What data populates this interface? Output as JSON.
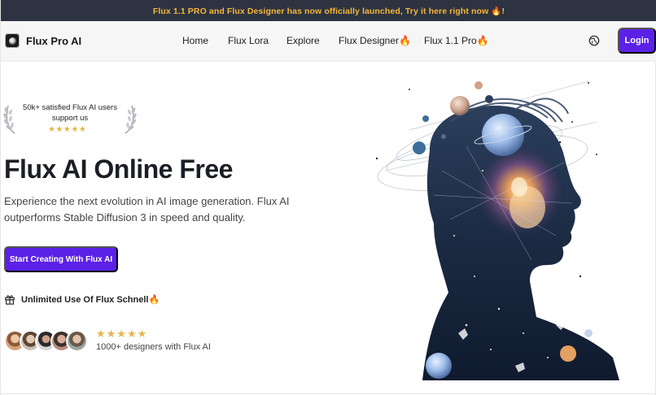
{
  "announcement": "Flux 1.1 PRO and Flux Designer has now officially launched, Try it here right now 🔥!",
  "nav": {
    "brand": "Flux Pro AI",
    "links": [
      "Home",
      "Flux Lora",
      "Explore",
      "Flux Designer🔥",
      "Flux 1.1 Pro🔥"
    ],
    "login": "Login",
    "globe_icon": "globe-icon"
  },
  "hero": {
    "proof_text": "50k+ satisfied Flux AI users support us",
    "proof_stars": "★★★★★",
    "title": "Flux AI Online Free",
    "subtitle": "Experience the next evolution in AI image generation. Flux AI outperforms Stable Diffusion 3 in speed and quality.",
    "cta": "Start Creating With Flux AI",
    "unlimited": "Unlimited Use Of Flux Schnell🔥",
    "rating_stars": "★★★★★",
    "rating_text": "1000+ designers with Flux AI"
  },
  "colors": {
    "announcement_bg": "#2d3340",
    "announcement_text": "#f5b63a",
    "accent": "#5b21e6",
    "star": "#e6b54a"
  }
}
